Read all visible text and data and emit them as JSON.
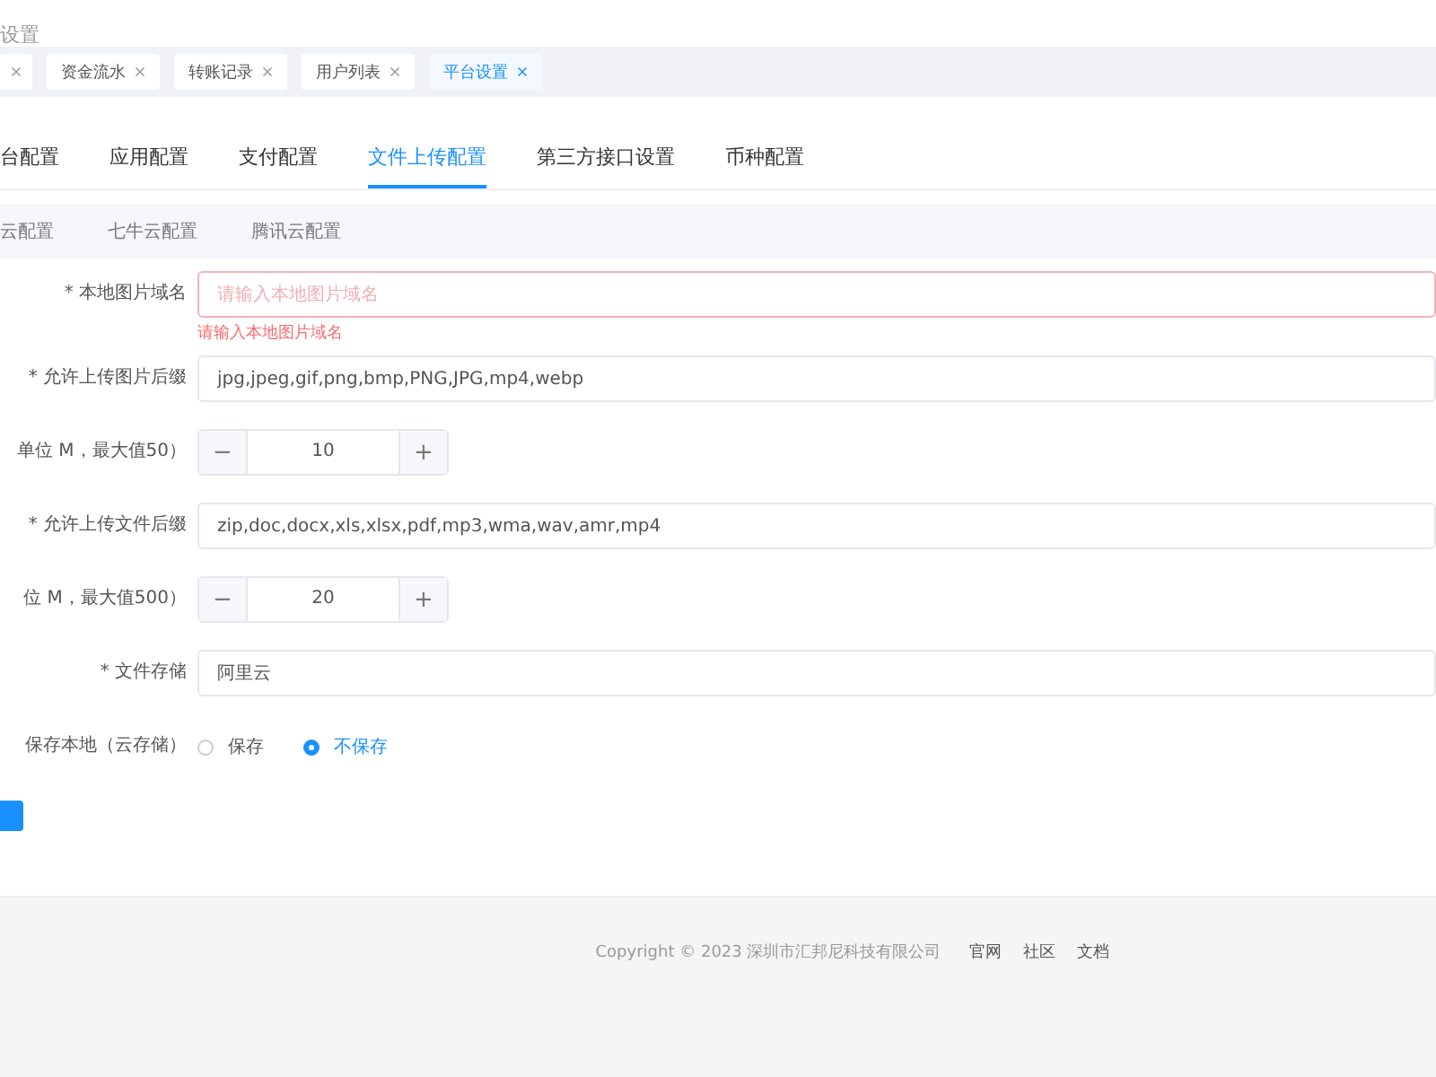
{
  "page_title": "设置",
  "tags": [
    {
      "selected": false
    },
    {
      "label": "资金流水",
      "selected": false
    },
    {
      "label": "转账记录",
      "selected": false
    },
    {
      "label": "用户列表",
      "selected": false
    },
    {
      "label": "平台设置",
      "selected": true
    }
  ],
  "tabs": [
    {
      "label": "台配置",
      "selected": false
    },
    {
      "label": "应用配置",
      "selected": false
    },
    {
      "label": "支付配置",
      "selected": false
    },
    {
      "label": "文件上传配置",
      "selected": true
    },
    {
      "label": "第三方接口设置",
      "selected": false
    },
    {
      "label": "币种配置",
      "selected": false
    }
  ],
  "sub_tabs": [
    {
      "label": "云配置",
      "selected": false
    },
    {
      "label": "七牛云配置",
      "selected": false
    },
    {
      "label": "腾讯云配置",
      "selected": false
    }
  ],
  "form": [
    {
      "kind": "text",
      "label": "* 本地图片域名",
      "placeholder": "请输入本地图片域名",
      "error": "请输入本地图片域名"
    },
    {
      "kind": "text",
      "label": "* 允许上传图片后缀",
      "value": "jpg,jpeg,gif,png,bmp,PNG,JPG,mp4,webp"
    },
    {
      "kind": "number",
      "label": "单位 M，最大值50）",
      "value": "10",
      "minus": "−",
      "plus": "+"
    },
    {
      "kind": "text",
      "label": "* 允许上传文件后缀",
      "value": "zip,doc,docx,xls,xlsx,pdf,mp3,wma,wav,amr,mp4"
    },
    {
      "kind": "number",
      "label": "位 M，最大值500）",
      "value": "20",
      "minus": "−",
      "plus": "+"
    },
    {
      "kind": "text",
      "label": "* 文件存储",
      "value": "阿里云"
    },
    {
      "kind": "radio",
      "label": "保存本地（云存储）",
      "options": [
        {
          "label": "保存",
          "selected": false
        },
        {
          "label": "不保存",
          "selected": true
        }
      ]
    }
  ],
  "footer": {
    "copyright": "Copyright © 2023 深圳市汇邦尼科技有限公司",
    "links": [
      "官网",
      "社区",
      "文档"
    ]
  }
}
